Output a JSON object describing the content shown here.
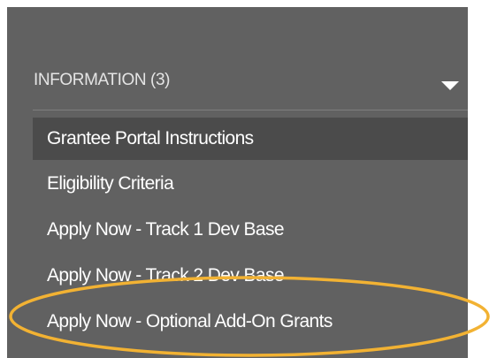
{
  "section": {
    "title": "INFORMATION (3)",
    "toggle_icon": "chevron-down-icon"
  },
  "menu": {
    "items": [
      {
        "label": "Grantee Portal Instructions",
        "active": true
      },
      {
        "label": "Eligibility Criteria",
        "active": false
      },
      {
        "label": "Apply Now - Track 1 Dev Base",
        "active": false
      },
      {
        "label": "Apply Now - Track 2 Dev Base",
        "active": false
      },
      {
        "label": "Apply Now - Optional Add-On Grants",
        "active": false
      }
    ]
  },
  "annotation": {
    "shape": "ellipse",
    "color": "#f2b233",
    "target": "Apply Now - Optional Add-On Grants"
  },
  "colors": {
    "panel_bg": "#616161",
    "active_item_bg": "#4b4b4b",
    "text": "#ffffff"
  }
}
